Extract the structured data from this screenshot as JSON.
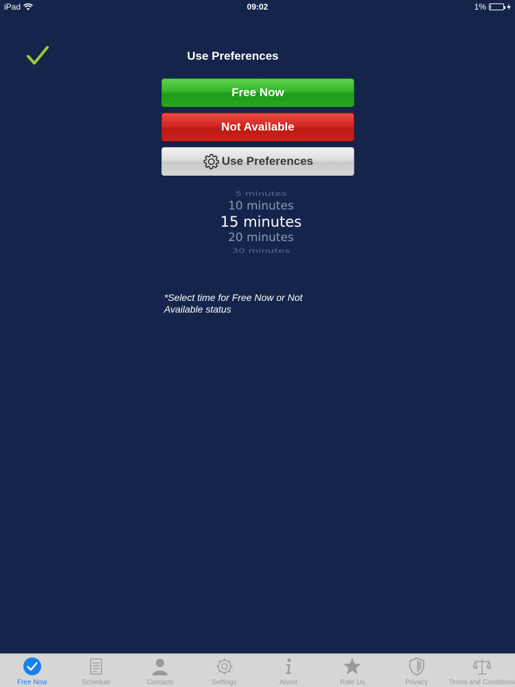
{
  "status_bar": {
    "device": "iPad",
    "time": "09:02",
    "battery": "1%"
  },
  "header": {
    "title": "Use Preferences"
  },
  "buttons": {
    "free_now": "Free Now",
    "not_available": "Not Available",
    "use_preferences": "Use Preferences"
  },
  "picker": {
    "items": [
      "5 minutes",
      "10 minutes",
      "15 minutes",
      "20 minutes",
      "30 minutes"
    ],
    "selected": "15 minutes"
  },
  "note": "*Select time for Free Now or Not Available status",
  "tabs": [
    {
      "label": "Free Now",
      "icon": "check-circle-icon",
      "active": true
    },
    {
      "label": "Schedule",
      "icon": "document-icon",
      "active": false
    },
    {
      "label": "Contacts",
      "icon": "person-icon",
      "active": false
    },
    {
      "label": "Settings",
      "icon": "gear-icon",
      "active": false
    },
    {
      "label": "About",
      "icon": "info-icon",
      "active": false
    },
    {
      "label": "Rate Us",
      "icon": "star-icon",
      "active": false
    },
    {
      "label": "Privacy",
      "icon": "shield-icon",
      "active": false
    },
    {
      "label": "Terms and Conditions",
      "icon": "scales-icon",
      "active": false
    }
  ],
  "colors": {
    "background": "#14244a",
    "free_now": "#33b52a",
    "not_available": "#d42721",
    "active_tab": "#1a7ef0",
    "checkmark": "#9acd32"
  }
}
